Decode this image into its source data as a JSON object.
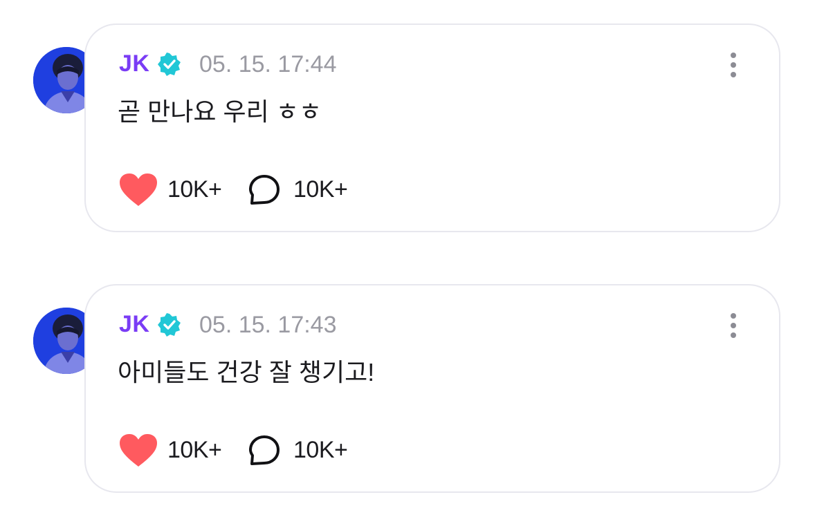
{
  "posts": [
    {
      "author": "JK",
      "verified_icon": "verified-badge-icon",
      "timestamp": "05. 15. 17:44",
      "text": "곧 만나요 우리 ㅎㅎ",
      "likes": "10K+",
      "comments": "10K+"
    },
    {
      "author": "JK",
      "verified_icon": "verified-badge-icon",
      "timestamp": "05. 15. 17:43",
      "text": "아미들도 건강 잘 챙기고!",
      "likes": "10K+",
      "comments": "10K+"
    }
  ],
  "colors": {
    "author": "#7a3cf5",
    "verified": "#21c7d6",
    "heart": "#ff5a5f",
    "timestamp": "#9a9aa2",
    "card_border": "#e7e7ee"
  }
}
